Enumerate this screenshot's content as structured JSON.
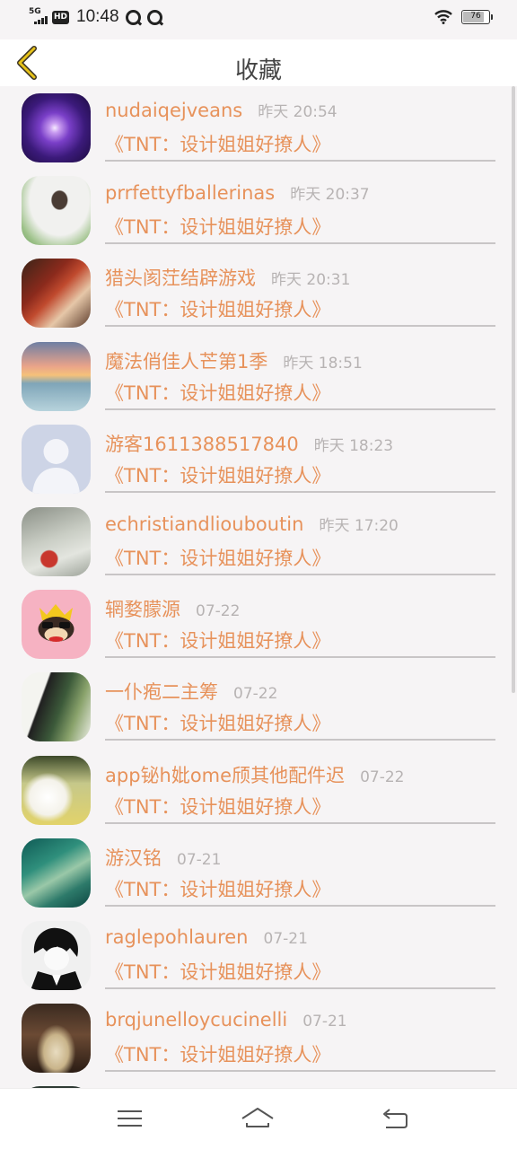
{
  "status": {
    "network": "5G",
    "hd": "HD",
    "time": "10:48",
    "battery": "76"
  },
  "header": {
    "title": "收藏"
  },
  "favorites": [
    {
      "name": "nudaiqejveans",
      "time": "昨天 20:54",
      "subtitle": "《TNT：设计姐姐好撩人》"
    },
    {
      "name": "prrfettyfballerinas",
      "time": "昨天 20:37",
      "subtitle": "《TNT：设计姐姐好撩人》"
    },
    {
      "name": "猎头阂茳结辟游戏",
      "time": "昨天 20:31",
      "subtitle": "《TNT：设计姐姐好撩人》"
    },
    {
      "name": "魔法俏佳人芒第1季",
      "time": "昨天 18:51",
      "subtitle": "《TNT：设计姐姐好撩人》"
    },
    {
      "name": "游客1611388517840",
      "time": "昨天 18:23",
      "subtitle": "《TNT：设计姐姐好撩人》"
    },
    {
      "name": "echristiandlioubouti­n",
      "time": "昨天 17:20",
      "subtitle": "《TNT：设计姐姐好撩人》"
    },
    {
      "name": "辋婺朦源",
      "time": "07-22",
      "subtitle": "《TNT：设计姐姐好撩人》"
    },
    {
      "name": "一仆疱二主筹",
      "time": "07-22",
      "subtitle": "《TNT：设计姐姐好撩人》"
    },
    {
      "name": "app铋h妣ome颀其他配件迟",
      "time": "07-22",
      "subtitle": "《TNT：设计姐姐好撩人》"
    },
    {
      "name": "游汉铭",
      "time": "07-21",
      "subtitle": "《TNT：设计姐姐好撩人》"
    },
    {
      "name": "raglepohlauren",
      "time": "07-21",
      "subtitle": "《TNT：设计姐姐好撩人》"
    },
    {
      "name": "brqjunelloycucinelli",
      "time": "07-21",
      "subtitle": "《TNT：设计姐姐好撩人》"
    }
  ],
  "nav": {
    "menu_icon": "menu-icon",
    "home_icon": "home-icon",
    "back_icon": "return-icon"
  },
  "colors": {
    "accent": "#e7925b",
    "time_gray": "#b7b3b3",
    "background": "#f6f4f5",
    "back_arrow": "#e6c21a"
  }
}
